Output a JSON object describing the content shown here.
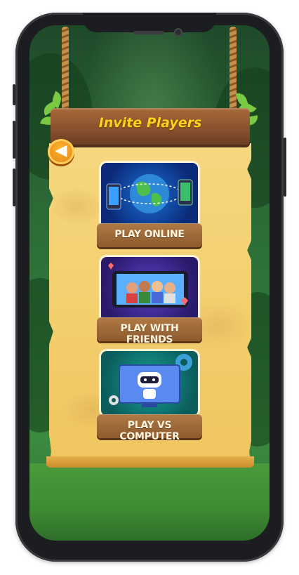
{
  "header": {
    "title": "Invite Players"
  },
  "options": [
    {
      "label": "PLAY ONLINE",
      "icon": "globe-phones-icon"
    },
    {
      "label": "PLAY WITH FRIENDS",
      "icon": "friends-tablet-icon"
    },
    {
      "label": "PLAY VS  COMPUTER",
      "icon": "robot-monitor-icon"
    }
  ],
  "colors": {
    "title": "#ffd21f",
    "wood": "#8e5a2e",
    "parchment": "#f3cf6e",
    "back_button": "#f39a1c"
  }
}
